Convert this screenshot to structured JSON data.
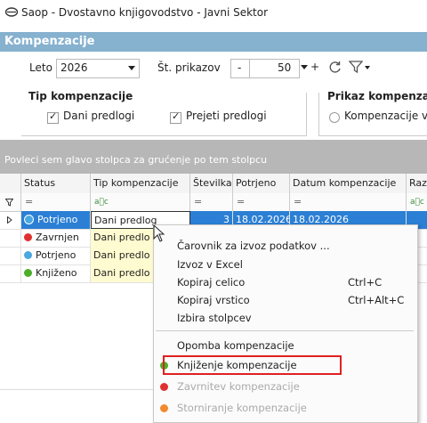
{
  "window": {
    "title": "Saop - Dvostavno knjigovodstvo - Javni Sektor"
  },
  "section": {
    "title": "Kompenzacije"
  },
  "toolbar": {
    "year_label": "Leto",
    "year_value": "2026",
    "count_label": "Št. prikazov",
    "minus": "-",
    "count_value": "50",
    "plus": "+",
    "refresh_icon": "refresh-icon",
    "filter_icon": "filter-icon"
  },
  "tip_group": {
    "title": "Tip kompenzacije",
    "options": [
      "Dani predlogi",
      "Prejeti predlogi"
    ]
  },
  "prikaz_group": {
    "title": "Prikaz kompenzac",
    "option": "Kompenzacije v"
  },
  "group_band": {
    "text": "Povleci sem glavo stolpca za grućenje po tem stolpcu"
  },
  "grid": {
    "columns": [
      "Status",
      "Tip kompenzacije",
      "Številka",
      "Potrjeno",
      "Datum kompenzacije",
      "Raz"
    ],
    "filters": [
      "=",
      "a⃞c",
      "=",
      "=",
      "=",
      "a⃞c"
    ],
    "rows": [
      {
        "status": "Potrjeno",
        "status_color": "#4aa8e0",
        "tip": "Dani predlog",
        "stevilka": "3",
        "potrjeno": "18.02.2026",
        "datum": "18.02.2026"
      },
      {
        "status": "Zavrnjen",
        "status_color": "#e03030",
        "tip": "Dani predlo",
        "stevilka": "",
        "potrjeno": "",
        "datum": ""
      },
      {
        "status": "Potrjeno",
        "status_color": "#4aa8e0",
        "tip": "Dani predlo",
        "stevilka": "",
        "potrjeno": "",
        "datum": ""
      },
      {
        "status": "Knjiženo",
        "status_color": "#4caf2a",
        "tip": "Dani predlo",
        "stevilka": "",
        "potrjeno": "",
        "datum": ""
      }
    ]
  },
  "context_menu": {
    "wizard": "Čarovnik za izvoz podatkov ...",
    "excel": "Izvoz v Excel",
    "copy_cell": "Kopiraj celico",
    "copy_cell_shortcut": "Ctrl+C",
    "copy_row": "Kopiraj vrstico",
    "copy_row_shortcut": "Ctrl+Alt+C",
    "columns": "Izbira stolpcev",
    "note": "Opomba kompenzacije",
    "post": "Knjiženje kompenzacije",
    "post_color": "#4caf2a",
    "reject": "Zavrnitev kompenzacije",
    "reject_color": "#e03030",
    "cancel": "Storniranje kompenzacije",
    "cancel_color": "#f08a30"
  }
}
